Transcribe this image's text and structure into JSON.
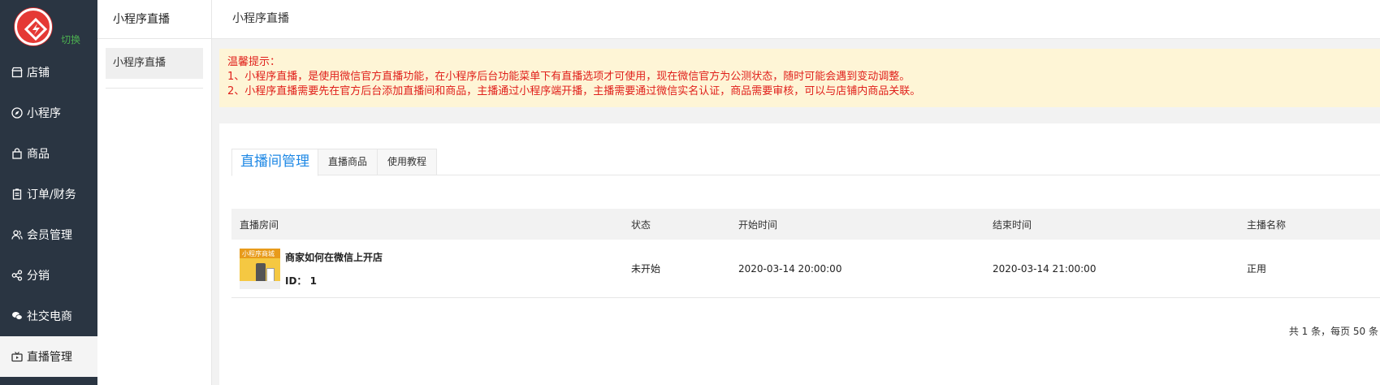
{
  "sidebar": {
    "switch_label": "切换",
    "items": [
      {
        "label": "店铺",
        "icon": "store-icon"
      },
      {
        "label": "小程序",
        "icon": "compass-icon"
      },
      {
        "label": "商品",
        "icon": "bag-icon"
      },
      {
        "label": "订单/财务",
        "icon": "clipboard-icon"
      },
      {
        "label": "会员管理",
        "icon": "users-icon"
      },
      {
        "label": "分销",
        "icon": "share-icon"
      },
      {
        "label": "社交电商",
        "icon": "chat-icon"
      },
      {
        "label": "直播管理",
        "icon": "video-icon"
      }
    ]
  },
  "subnav": {
    "title": "小程序直播",
    "item": "小程序直播"
  },
  "header": {
    "breadcrumb": "小程序直播"
  },
  "notice": {
    "title": "温馨提示：",
    "line1": "1、小程序直播，是使用微信官方直播功能，在小程序后台功能菜单下有直播选项才可使用，现在微信官方为公测状态，随时可能会遇到变动调整。",
    "line2": "2、小程序直播需要先在官方后台添加直播间和商品，主播通过小程序端开播，主播需要通过微信实名认证，商品需要审核，可以与店铺内商品关联。"
  },
  "tabs": [
    "直播间管理",
    "直播商品",
    "使用教程"
  ],
  "table": {
    "headers": [
      "直播房间",
      "状态",
      "开始时间",
      "结束时间",
      "主播名称"
    ],
    "rows": [
      {
        "title": "商家如何在微信上开店",
        "id": "ID： 1",
        "thumb_text": "小程序商城",
        "status": "未开始",
        "start": "2020-03-14 20:00:00",
        "end": "2020-03-14 21:00:00",
        "anchor": "正用"
      }
    ]
  },
  "pager": "共 1 条，每页 50 条",
  "colors": {
    "sidebar": "#2a3542",
    "notice_bg": "#fef5d6",
    "notice_text": "#e0201b",
    "tab_active": "#1e88e5",
    "switch": "#4caf50"
  }
}
